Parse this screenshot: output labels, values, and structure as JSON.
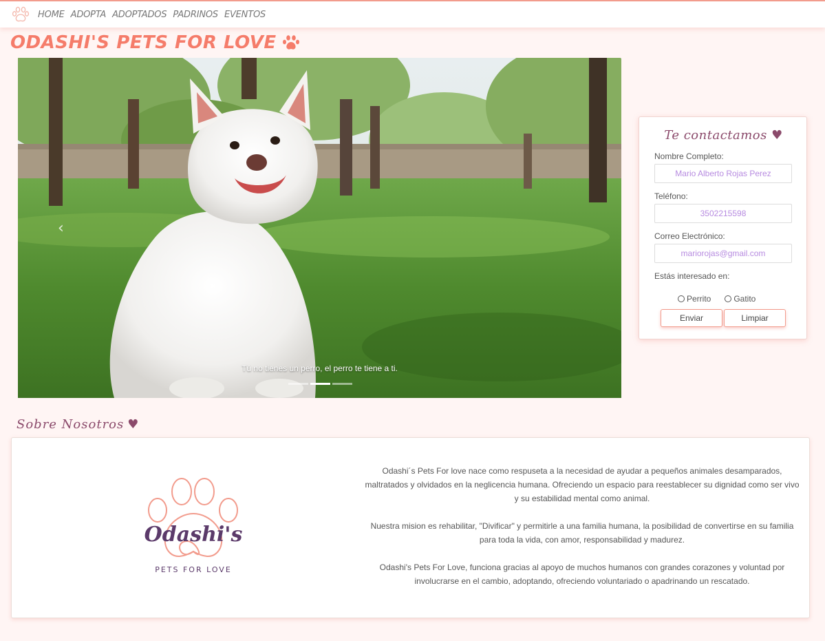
{
  "nav": {
    "items": [
      "HOME",
      "ADOPTA",
      "ADOPTADOS",
      "PADRINOS",
      "EVENTOS"
    ]
  },
  "brand": {
    "title": "ODASHI'S PETS FOR LOVE",
    "icon": "paw-icon"
  },
  "carousel": {
    "caption": "Tú no tienes un perro, el perro te tiene a ti.",
    "slides": 3,
    "active_index": 1
  },
  "contact": {
    "title": "Te contactamos",
    "name_label": "Nombre Completo:",
    "name_value": "Mario Alberto Rojas Perez",
    "phone_label": "Teléfono:",
    "phone_value": "3502215598",
    "email_label": "Correo Electrónico:",
    "email_value": "mariorojas@gmail.com",
    "interest_label": "Estás interesado en:",
    "option_dog": "Perrito",
    "option_cat": "Gatito",
    "submit_label": "Enviar",
    "clear_label": "Limpiar"
  },
  "about": {
    "title": "Sobre Nosotros",
    "logo_text": "Odashi's",
    "logo_subtext": "PETS FOR LOVE",
    "p1": "Odashi´s Pets For love nace como respuseta a la necesidad de ayudar a pequeños animales desamparados, maltratados y olvidados en la neglicencia humana. Ofreciendo un espacio para reestablecer su dignidad como ser vivo y su estabilidad mental como animal.",
    "p2": "Nuestra mision es rehabilitar, \"Divificar\" y permitirle a una familia humana, la posibilidad de convertirse en su familia para toda la vida, con amor, responsabilidad y madurez.",
    "p3": "Odashi's Pets For Love, funciona gracias al apoyo de muchos humanos con grandes corazones y voluntad por involucrarse en el cambio, adoptando, ofreciendo voluntariado o apadrinando un rescatado."
  },
  "colors": {
    "accent": "#f57c6a",
    "heading": "#8b4a6b",
    "background": "#fff5f4"
  }
}
